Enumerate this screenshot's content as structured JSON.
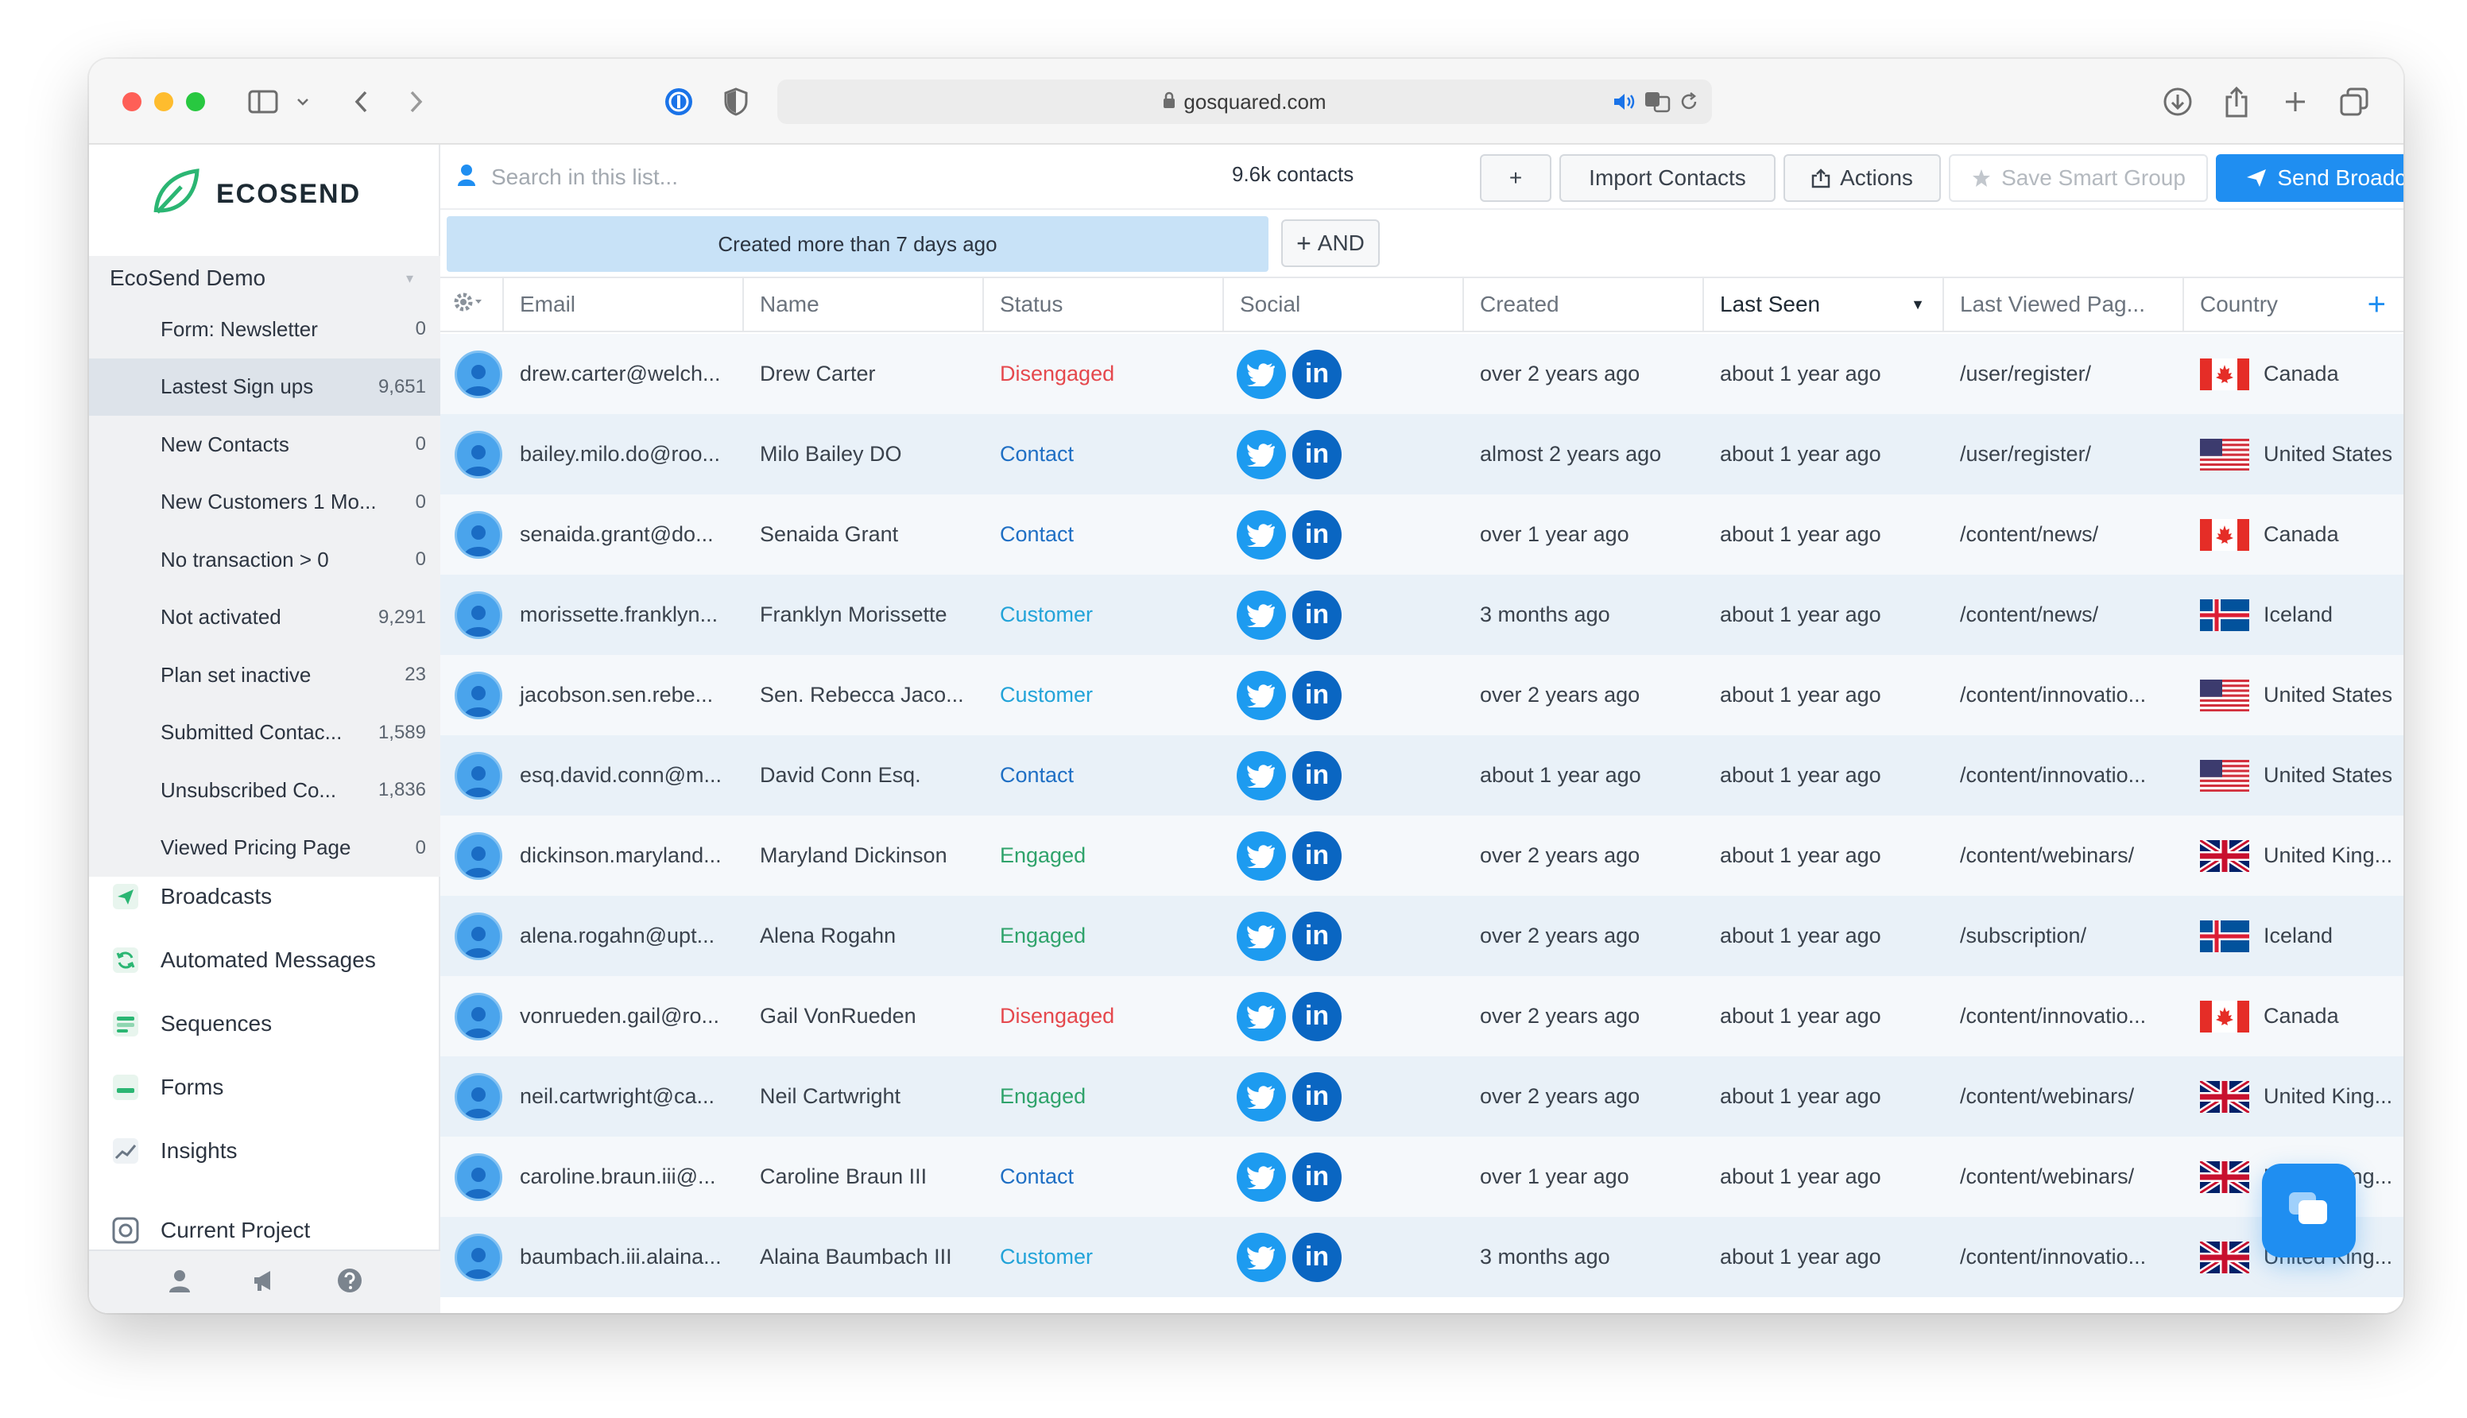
{
  "browser": {
    "url": "gosquared.com"
  },
  "sidebar": {
    "brand": "ECOSEND",
    "project": "EcoSend Demo",
    "smart_lists": [
      {
        "label": "Form: Newsletter",
        "count": "0"
      },
      {
        "label": "Lastest Sign ups",
        "count": "9,651",
        "active": true
      },
      {
        "label": "New Contacts",
        "count": "0"
      },
      {
        "label": "New Customers 1 Mo...",
        "count": "0"
      },
      {
        "label": "No transaction > 0",
        "count": "0"
      },
      {
        "label": "Not activated",
        "count": "9,291"
      },
      {
        "label": "Plan set inactive",
        "count": "23"
      },
      {
        "label": "Submitted Contac...",
        "count": "1,589"
      },
      {
        "label": "Unsubscribed Co...",
        "count": "1,836"
      },
      {
        "label": "Viewed Pricing Page",
        "count": "0"
      }
    ],
    "nav": [
      {
        "label": "Broadcasts",
        "icon": "paper-plane-icon"
      },
      {
        "label": "Automated Messages",
        "icon": "refresh-icon"
      },
      {
        "label": "Sequences",
        "icon": "sequence-icon"
      },
      {
        "label": "Forms",
        "icon": "form-icon"
      },
      {
        "label": "Insights",
        "icon": "chart-icon"
      },
      {
        "label": "Current Project",
        "icon": "project-icon"
      }
    ]
  },
  "toolbar": {
    "search_placeholder": "Search in this list...",
    "contact_count": "9.6k contacts",
    "add_label": "+",
    "import_label": "Import Contacts",
    "actions_label": "Actions",
    "save_label": "Save Smart Group",
    "send_label": "Send Broadcast"
  },
  "filter": {
    "chip": "Created more than 7 days ago",
    "and_label": "AND"
  },
  "table": {
    "columns": [
      "Email",
      "Name",
      "Status",
      "Social",
      "Created",
      "Last Seen",
      "Last Viewed Pag...",
      "Country"
    ],
    "rows": [
      {
        "email": "drew.carter@welch...",
        "name": "Drew Carter",
        "status": "Disengaged",
        "created": "over 2 years ago",
        "seen": "about 1 year ago",
        "page": "/user/register/",
        "country": "Canada",
        "flag": "ca"
      },
      {
        "email": "bailey.milo.do@roo...",
        "name": "Milo Bailey DO",
        "status": "Contact",
        "created": "almost 2 years ago",
        "seen": "about 1 year ago",
        "page": "/user/register/",
        "country": "United States",
        "flag": "us"
      },
      {
        "email": "senaida.grant@do...",
        "name": "Senaida Grant",
        "status": "Contact",
        "created": "over 1 year ago",
        "seen": "about 1 year ago",
        "page": "/content/news/",
        "country": "Canada",
        "flag": "ca"
      },
      {
        "email": "morissette.franklyn...",
        "name": "Franklyn Morissette",
        "status": "Customer",
        "created": "3 months ago",
        "seen": "about 1 year ago",
        "page": "/content/news/",
        "country": "Iceland",
        "flag": "is"
      },
      {
        "email": "jacobson.sen.rebe...",
        "name": "Sen. Rebecca Jaco...",
        "status": "Customer",
        "created": "over 2 years ago",
        "seen": "about 1 year ago",
        "page": "/content/innovatio...",
        "country": "United States",
        "flag": "us"
      },
      {
        "email": "esq.david.conn@m...",
        "name": "David Conn Esq.",
        "status": "Contact",
        "created": "about 1 year ago",
        "seen": "about 1 year ago",
        "page": "/content/innovatio...",
        "country": "United States",
        "flag": "us"
      },
      {
        "email": "dickinson.maryland...",
        "name": "Maryland Dickinson",
        "status": "Engaged",
        "created": "over 2 years ago",
        "seen": "about 1 year ago",
        "page": "/content/webinars/",
        "country": "United King...",
        "flag": "gb"
      },
      {
        "email": "alena.rogahn@upt...",
        "name": "Alena Rogahn",
        "status": "Engaged",
        "created": "over 2 years ago",
        "seen": "about 1 year ago",
        "page": "/subscription/",
        "country": "Iceland",
        "flag": "is"
      },
      {
        "email": "vonrueden.gail@ro...",
        "name": "Gail VonRueden",
        "status": "Disengaged",
        "created": "over 2 years ago",
        "seen": "about 1 year ago",
        "page": "/content/innovatio...",
        "country": "Canada",
        "flag": "ca"
      },
      {
        "email": "neil.cartwright@ca...",
        "name": "Neil Cartwright",
        "status": "Engaged",
        "created": "over 2 years ago",
        "seen": "about 1 year ago",
        "page": "/content/webinars/",
        "country": "United King...",
        "flag": "gb"
      },
      {
        "email": "caroline.braun.iii@...",
        "name": "Caroline Braun III",
        "status": "Contact",
        "created": "over 1 year ago",
        "seen": "about 1 year ago",
        "page": "/content/webinars/",
        "country": "United King...",
        "flag": "gb"
      },
      {
        "email": "baumbach.iii.alaina...",
        "name": "Alaina Baumbach III",
        "status": "Customer",
        "created": "3 months ago",
        "seen": "about 1 year ago",
        "page": "/content/innovatio...",
        "country": "United King...",
        "flag": "gb"
      }
    ]
  },
  "colors": {
    "accent": "#1f8ef1",
    "filter_chip": "#c8e2f7",
    "disengaged": "#e5484d",
    "contact": "#1f6fc4",
    "customer": "#22a3d8",
    "engaged": "#2fa36b"
  }
}
